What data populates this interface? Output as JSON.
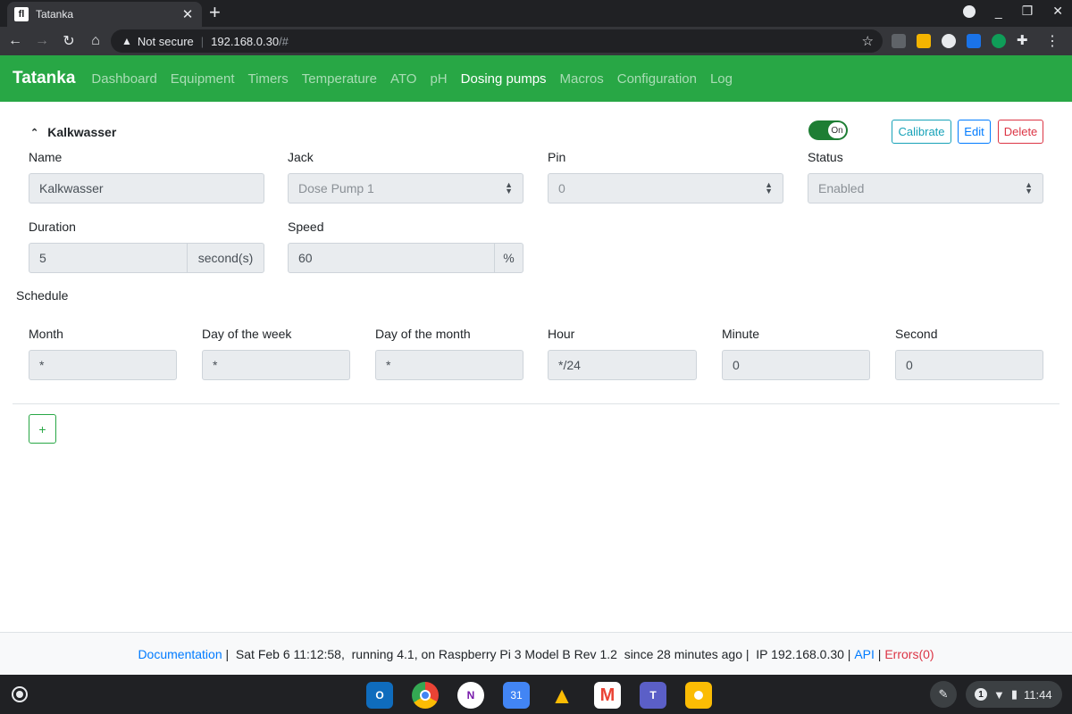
{
  "browser": {
    "tab_title": "Tatanka",
    "favicon_text": "fl",
    "security_label": "Not secure",
    "url_host": "192.168.0.30",
    "url_path": "/#"
  },
  "app": {
    "brand": "Tatanka",
    "nav": [
      "Dashboard",
      "Equipment",
      "Timers",
      "Temperature",
      "ATO",
      "pH",
      "Dosing pumps",
      "Macros",
      "Configuration",
      "Log"
    ],
    "active_nav": "Dosing pumps",
    "accent_color": "#28a745"
  },
  "pump": {
    "title": "Kalkwasser",
    "switch_label": "On",
    "buttons": {
      "calibrate": "Calibrate",
      "edit": "Edit",
      "delete": "Delete"
    },
    "labels": {
      "name": "Name",
      "jack": "Jack",
      "pin": "Pin",
      "status": "Status",
      "duration": "Duration",
      "speed": "Speed"
    },
    "name": "Kalkwasser",
    "jack": "Dose Pump 1",
    "pin": "0",
    "status": "Enabled",
    "duration": "5",
    "duration_unit": "second(s)",
    "speed": "60",
    "speed_unit": "%"
  },
  "schedule": {
    "title": "Schedule",
    "labels": {
      "month": "Month",
      "day_of_week": "Day of the week",
      "day_of_month": "Day of the month",
      "hour": "Hour",
      "minute": "Minute",
      "second": "Second"
    },
    "month": "*",
    "day_of_week": "*",
    "day_of_month": "*",
    "hour": "*/24",
    "minute": "0",
    "second": "0"
  },
  "add_button": "+",
  "footer": {
    "documentation": "Documentation",
    "info": " |  Sat Feb 6 11:12:58,  running 4.1, on Raspberry Pi 3 Model B Rev 1.2  since 28 minutes ago |  IP 192.168.0.30 | ",
    "api": "API",
    "sep": " | ",
    "errors": "Errors(0)"
  },
  "shelf": {
    "apps": [
      "outlook-icon",
      "chrome-icon",
      "onenote-icon",
      "calendar-icon",
      "drive-icon",
      "gmail-icon",
      "teams-icon",
      "keep-icon"
    ],
    "calendar_day": "31",
    "notification_count": "1",
    "time": "11:44"
  }
}
